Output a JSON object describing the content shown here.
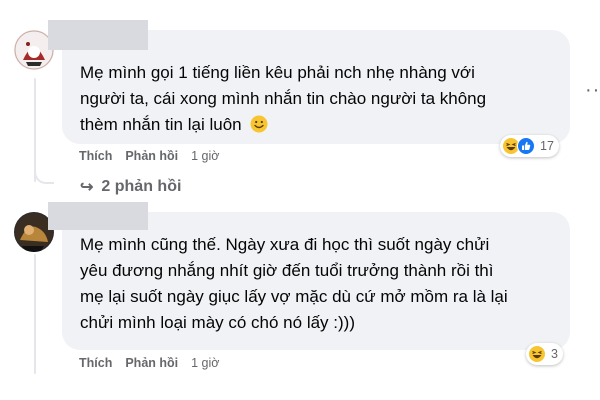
{
  "comments": [
    {
      "text_lines": [
        "Mẹ mình gọi 1 tiếng liền kêu phải nch nhẹ nhàng với",
        "người ta, cái xong mình nhắn tin chào người ta không",
        "thèm nhắn tin lại luôn"
      ],
      "emoji_icon": "smiling-face-icon",
      "actions": {
        "like": "Thích",
        "reply": "Phản hồi",
        "time": "1 giờ"
      },
      "reactions": {
        "icons": [
          "haha-icon",
          "like-icon"
        ],
        "count": "17"
      },
      "replies_label": "2 phản hồi"
    },
    {
      "text_lines": [
        "Mẹ mình cũng thế. Ngày xưa đi học thì suốt ngày chửi",
        "yêu đương nhắng nhít giờ đến tuổi trưởng thành rồi thì",
        "mẹ lại suốt ngày giục lấy vợ mặc dù cứ mở mồm ra là lại",
        "chửi mình loại mày có chó nó lấy :)))"
      ],
      "actions": {
        "like": "Thích",
        "reply": "Phản hồi",
        "time": "1 giờ"
      },
      "reactions": {
        "icons": [
          "haha-icon"
        ],
        "count": "3"
      }
    }
  ],
  "more_icon": "more-options-icon",
  "colors": {
    "bubble": "#f0f2f5",
    "text": "#050505",
    "meta": "#65676b",
    "name_redaction": "#d8dadf"
  }
}
